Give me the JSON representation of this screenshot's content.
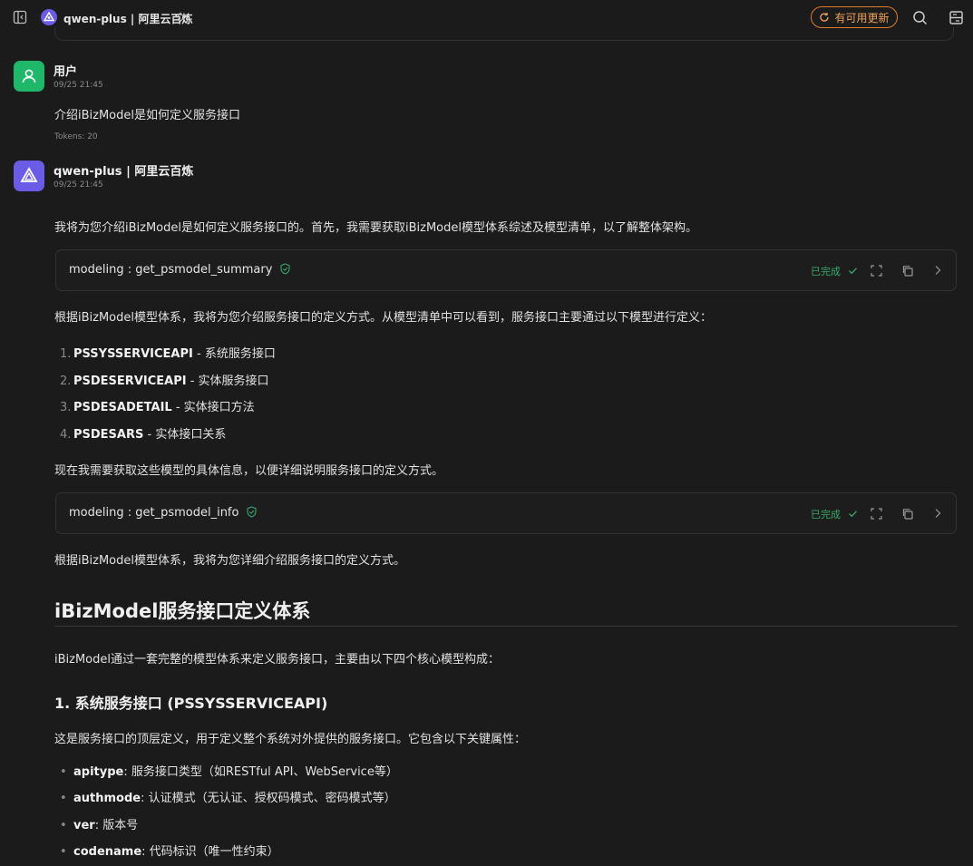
{
  "header": {
    "model_name": "qwen-plus | 阿里云百炼",
    "update_label": "有可用更新",
    "icons": [
      "sidebar-toggle-icon",
      "chevron-updown-icon",
      "refresh-icon",
      "search-icon",
      "layout-icon"
    ]
  },
  "user_msg": {
    "name": "用户",
    "time": "09/25 21:45",
    "text": "介绍iBizModel是如何定义服务接口",
    "tokens": "Tokens: 20"
  },
  "assistant": {
    "name": "qwen-plus | 阿里云百炼",
    "time": "09/25 21:45",
    "intro": "我将为您介绍iBizModel是如何定义服务接口的。首先，我需要获取iBizModel模型体系综述及模型清单，以了解整体架构。",
    "tool1": {
      "name": "modeling : get_psmodel_summary",
      "status": "已完成"
    },
    "para2": "根据iBizModel模型体系，我将为您介绍服务接口的定义方式。从模型清单中可以看到，服务接口主要通过以下模型进行定义：",
    "list": [
      {
        "num": "1.",
        "term": "PSSYSSERVICEAPI",
        "desc": " - 系统服务接口"
      },
      {
        "num": "2.",
        "term": "PSDESERVICEAPI",
        "desc": " - 实体服务接口"
      },
      {
        "num": "3.",
        "term": "PSDESADETAIL",
        "desc": " - 实体接口方法"
      },
      {
        "num": "4.",
        "term": "PSDESARS",
        "desc": " - 实体接口关系"
      }
    ],
    "para3": "现在我需要获取这些模型的具体信息，以便详细说明服务接口的定义方式。",
    "tool2": {
      "name": "modeling : get_psmodel_info",
      "status": "已完成"
    },
    "para4": "根据iBizModel模型体系，我将为您详细介绍服务接口的定义方式。",
    "h2": "iBizModel服务接口定义体系",
    "para5": "iBizModel通过一套完整的模型体系来定义服务接口，主要由以下四个核心模型构成：",
    "h3": "1. 系统服务接口 (PSSYSSERVICEAPI)",
    "para6": "这是服务接口的顶层定义，用于定义整个系统对外提供的服务接口。它包含以下关键属性：",
    "bullets": [
      {
        "term": "apitype",
        "desc": ": 服务接口类型（如RESTful API、WebService等）"
      },
      {
        "term": "authmode",
        "desc": ": 认证模式（无认证、授权码模式、密码模式等）"
      },
      {
        "term": "ver",
        "desc": ": 版本号"
      },
      {
        "term": "codename",
        "desc": ": 代码标识（唯一性约束）"
      }
    ]
  },
  "colors": {
    "accent_green": "#3aa86b",
    "update_orange": "#e07b2a",
    "user_avatar": "#1fb86a",
    "assistant_avatar": "#6b5ce7"
  }
}
